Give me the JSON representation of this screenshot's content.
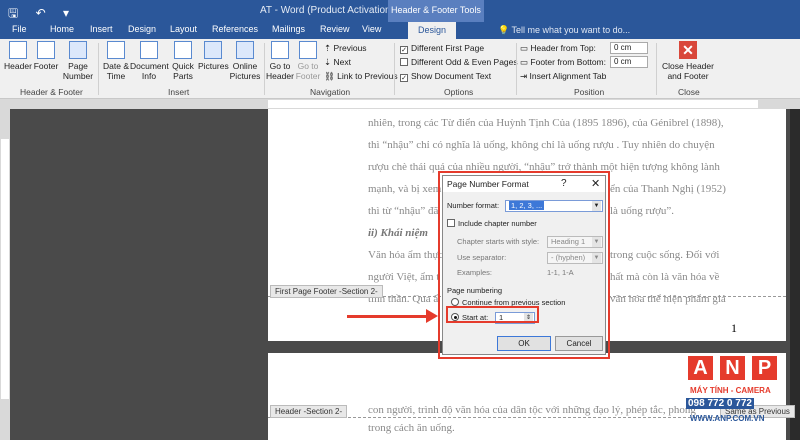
{
  "window": {
    "title": "AT - Word (Product Activation Failed)",
    "context_tab_group": "Header & Footer Tools",
    "tell_me": "Tell me what you want to do..."
  },
  "quick_access": [
    "save-icon",
    "undo-icon",
    "dropdown-icon"
  ],
  "tabs": [
    "File",
    "Home",
    "Insert",
    "Design",
    "Layout",
    "References",
    "Mailings",
    "Review",
    "View",
    "Design"
  ],
  "ribbon": {
    "header_footer": {
      "header": "Header",
      "footer": "Footer",
      "page_number": "Page Number",
      "group": "Header & Footer"
    },
    "insert": {
      "date_time": "Date & Time",
      "document_info": "Document Info",
      "quick_parts": "Quick Parts",
      "pictures": "Pictures",
      "online_pictures": "Online Pictures",
      "group": "Insert"
    },
    "navigation": {
      "go_to_header": "Go to Header",
      "go_to_footer": "Go to Footer",
      "previous": "Previous",
      "next": "Next",
      "link_to_previous": "Link to Previous",
      "group": "Navigation"
    },
    "options": {
      "different_first_page": "Different First Page",
      "different_odd_even": "Different Odd & Even Pages",
      "show_document_text": "Show Document Text",
      "group": "Options"
    },
    "position": {
      "header_from_top": "Header from Top:",
      "header_value": "0 cm",
      "footer_from_bottom": "Footer from Bottom:",
      "footer_value": "0 cm",
      "insert_alignment_tab": "Insert Alignment Tab",
      "group": "Position"
    },
    "close": {
      "label": "Close Header and Footer",
      "group": "Close"
    }
  },
  "document": {
    "lines": [
      "nhiên, trong các Từ điển của Huỳnh Tịnh Của (1895 1896), của Génibrel (1898),",
      "thì “nhậu” chỉ có nghĩa là uống, không chỉ là uống rượu . Tuy nhiên do chuyện",
      "rượu chè thái quá của nhiều người, “nhậu” trở thành một hiện tượng không lành",
      "mạnh, và bị xem",
      "thì từ “nhậu” đã",
      "Văn hóa ẩm thực",
      "người Việt, ẩm t",
      "tinh thần. Qua ẩ"
    ],
    "line_right_parts": [
      "ển của Thanh Nghị (1952)",
      "là uống rượu”.",
      "trong cuộc sống. Đối với",
      "hất mà còn là văn hóa về",
      "văn hóa thể hiện phẩm giá"
    ],
    "heading": "ii)  Khái niệm",
    "footer_tag": "First Page Footer -Section 2-",
    "page_number": "1",
    "header_tag": "Header -Section 2-",
    "page2_lines": [
      "con người, trình độ văn hóa của dân tộc với những đạo lý, phép tắc, phong tục",
      "trong cách ăn uống."
    ],
    "same_as_previous": "Same as Previous"
  },
  "dialog": {
    "title": "Page Number Format",
    "help": "?",
    "close": "✕",
    "number_format_label": "Number format:",
    "number_format_value": "1, 2, 3, ...",
    "include_chapter_number": "Include chapter number",
    "chapter_starts_label": "Chapter starts with style:",
    "chapter_starts_value": "Heading 1",
    "use_separator_label": "Use separator:",
    "use_separator_value": "-  (hyphen)",
    "examples_label": "Examples:",
    "examples_value": "1-1, 1-A",
    "page_numbering": "Page numbering",
    "continue_from_previous": "Continue from previous section",
    "start_at_label": "Start at:",
    "start_at_value": "1",
    "ok": "OK",
    "cancel": "Cancel"
  },
  "watermark": {
    "letters": [
      "A",
      "N",
      "P"
    ],
    "tagline": "MÁY TÍNH - CAMERA",
    "phone": "098 772 0 772",
    "site": "WWW.ANP.COM.VN"
  },
  "colors": {
    "word_blue": "#2b579a",
    "highlight_red": "#e53b2c",
    "selection_blue": "#3d78d8"
  }
}
